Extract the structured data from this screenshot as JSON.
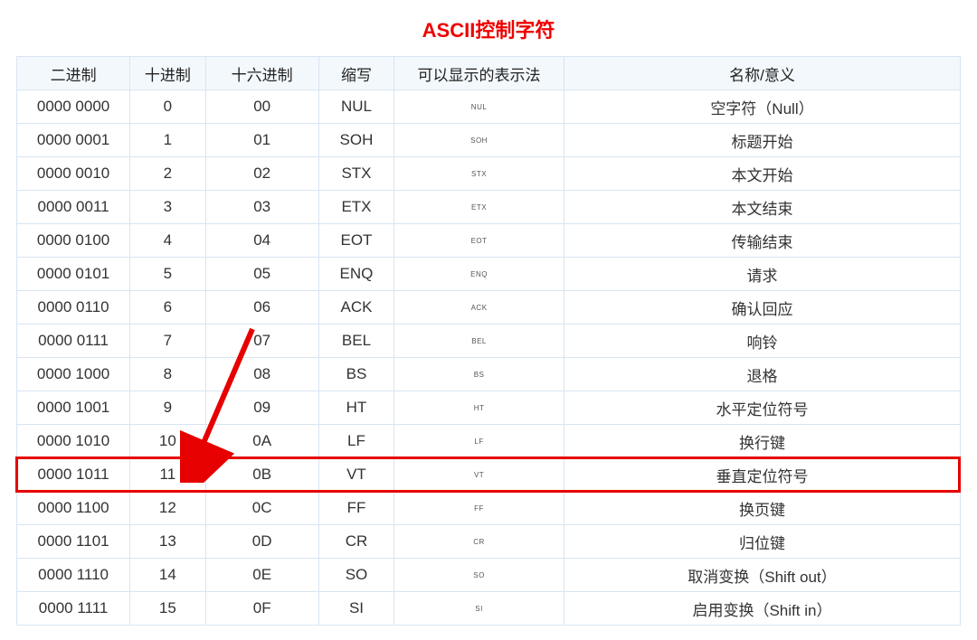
{
  "title": "ASCII控制字符",
  "headers": {
    "binary": "二进制",
    "decimal": "十进制",
    "hex": "十六进制",
    "abbr": "缩写",
    "display": "可以显示的表示法",
    "name": "名称/意义"
  },
  "rows": [
    {
      "bin": "0000 0000",
      "dec": "0",
      "hex": "00",
      "abbr": "NUL",
      "disp": "NUL",
      "name": "空字符（Null）"
    },
    {
      "bin": "0000 0001",
      "dec": "1",
      "hex": "01",
      "abbr": "SOH",
      "disp": "SOH",
      "name": "标题开始"
    },
    {
      "bin": "0000 0010",
      "dec": "2",
      "hex": "02",
      "abbr": "STX",
      "disp": "STX",
      "name": "本文开始"
    },
    {
      "bin": "0000 0011",
      "dec": "3",
      "hex": "03",
      "abbr": "ETX",
      "disp": "ETX",
      "name": "本文结束"
    },
    {
      "bin": "0000 0100",
      "dec": "4",
      "hex": "04",
      "abbr": "EOT",
      "disp": "EOT",
      "name": "传输结束"
    },
    {
      "bin": "0000 0101",
      "dec": "5",
      "hex": "05",
      "abbr": "ENQ",
      "disp": "ENQ",
      "name": "请求"
    },
    {
      "bin": "0000 0110",
      "dec": "6",
      "hex": "06",
      "abbr": "ACK",
      "disp": "ACK",
      "name": "确认回应"
    },
    {
      "bin": "0000 0111",
      "dec": "7",
      "hex": "07",
      "abbr": "BEL",
      "disp": "BEL",
      "name": "响铃"
    },
    {
      "bin": "0000 1000",
      "dec": "8",
      "hex": "08",
      "abbr": "BS",
      "disp": "BS",
      "name": "退格"
    },
    {
      "bin": "0000 1001",
      "dec": "9",
      "hex": "09",
      "abbr": "HT",
      "disp": "HT",
      "name": "水平定位符号"
    },
    {
      "bin": "0000 1010",
      "dec": "10",
      "hex": "0A",
      "abbr": "LF",
      "disp": "LF",
      "name": "换行键"
    },
    {
      "bin": "0000 1011",
      "dec": "11",
      "hex": "0B",
      "abbr": "VT",
      "disp": "VT",
      "name": "垂直定位符号"
    },
    {
      "bin": "0000 1100",
      "dec": "12",
      "hex": "0C",
      "abbr": "FF",
      "disp": "FF",
      "name": "换页键"
    },
    {
      "bin": "0000 1101",
      "dec": "13",
      "hex": "0D",
      "abbr": "CR",
      "disp": "CR",
      "name": "归位键"
    },
    {
      "bin": "0000 1110",
      "dec": "14",
      "hex": "0E",
      "abbr": "SO",
      "disp": "SO",
      "name": "取消变换（Shift out）"
    },
    {
      "bin": "0000 1111",
      "dec": "15",
      "hex": "0F",
      "abbr": "SI",
      "disp": "SI",
      "name": "启用变换（Shift in）"
    }
  ],
  "highlighted_row_index": 11,
  "annotation": {
    "arrow_color": "#e60000"
  }
}
